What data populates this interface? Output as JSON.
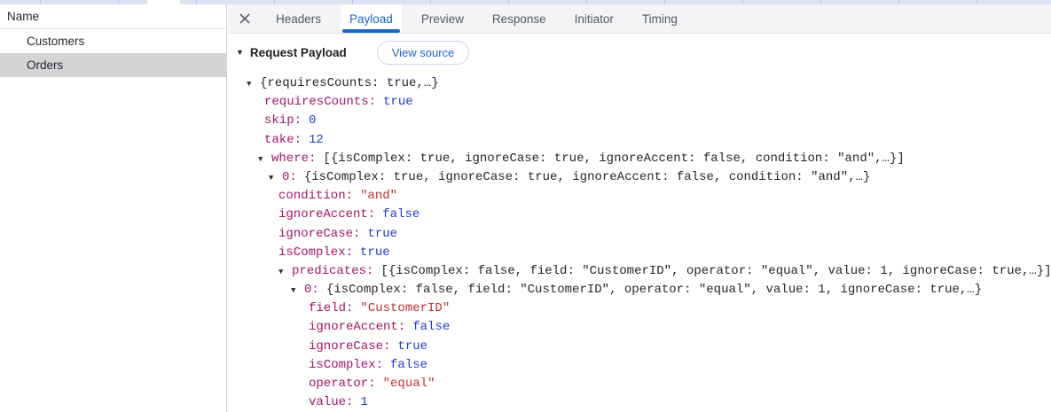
{
  "colors": {
    "accent_blue": "#1765cf",
    "key_color": "#a4156a",
    "string_color": "#c0332c",
    "number_color": "#2040cc",
    "selected_row_bg": "#d3d4d6"
  },
  "sidebar": {
    "header": "Name",
    "items": [
      {
        "label": "Customers",
        "selected": false
      },
      {
        "label": "Orders",
        "selected": true
      }
    ]
  },
  "tabs": {
    "items": [
      "Headers",
      "Payload",
      "Preview",
      "Response",
      "Initiator",
      "Timing"
    ],
    "active": "Payload"
  },
  "payload_section": {
    "title": "Request Payload",
    "view_source_label": "View source"
  },
  "tree": {
    "rows": [
      {
        "text": "{requiresCounts: true,…}",
        "type": "root",
        "expandable": true
      },
      {
        "key": "requiresCounts",
        "value": "true",
        "type": "boolean"
      },
      {
        "key": "skip",
        "value": "0",
        "type": "number"
      },
      {
        "key": "take",
        "value": "12",
        "type": "number"
      },
      {
        "key": "where",
        "preview": "[{isComplex: true, ignoreCase: true, ignoreAccent: false, condition: \"and\",…}]",
        "type": "preview",
        "expandable": true
      },
      {
        "key": "0",
        "preview": "{isComplex: true, ignoreCase: true, ignoreAccent: false, condition: \"and\",…}",
        "type": "preview",
        "expandable": true
      },
      {
        "key": "condition",
        "value": "\"and\"",
        "type": "string"
      },
      {
        "key": "ignoreAccent",
        "value": "false",
        "type": "boolean"
      },
      {
        "key": "ignoreCase",
        "value": "true",
        "type": "boolean"
      },
      {
        "key": "isComplex",
        "value": "true",
        "type": "boolean"
      },
      {
        "key": "predicates",
        "preview": "[{isComplex: false, field: \"CustomerID\", operator: \"equal\", value: 1, ignoreCase: true,…}]",
        "type": "preview",
        "expandable": true
      },
      {
        "key": "0",
        "preview": "{isComplex: false, field: \"CustomerID\", operator: \"equal\", value: 1, ignoreCase: true,…}",
        "type": "preview",
        "expandable": true
      },
      {
        "key": "field",
        "value": "\"CustomerID\"",
        "type": "string"
      },
      {
        "key": "ignoreAccent",
        "value": "false",
        "type": "boolean"
      },
      {
        "key": "ignoreCase",
        "value": "true",
        "type": "boolean"
      },
      {
        "key": "isComplex",
        "value": "false",
        "type": "boolean"
      },
      {
        "key": "operator",
        "value": "\"equal\"",
        "type": "string"
      },
      {
        "key": "value",
        "value": "1",
        "type": "number"
      }
    ]
  }
}
